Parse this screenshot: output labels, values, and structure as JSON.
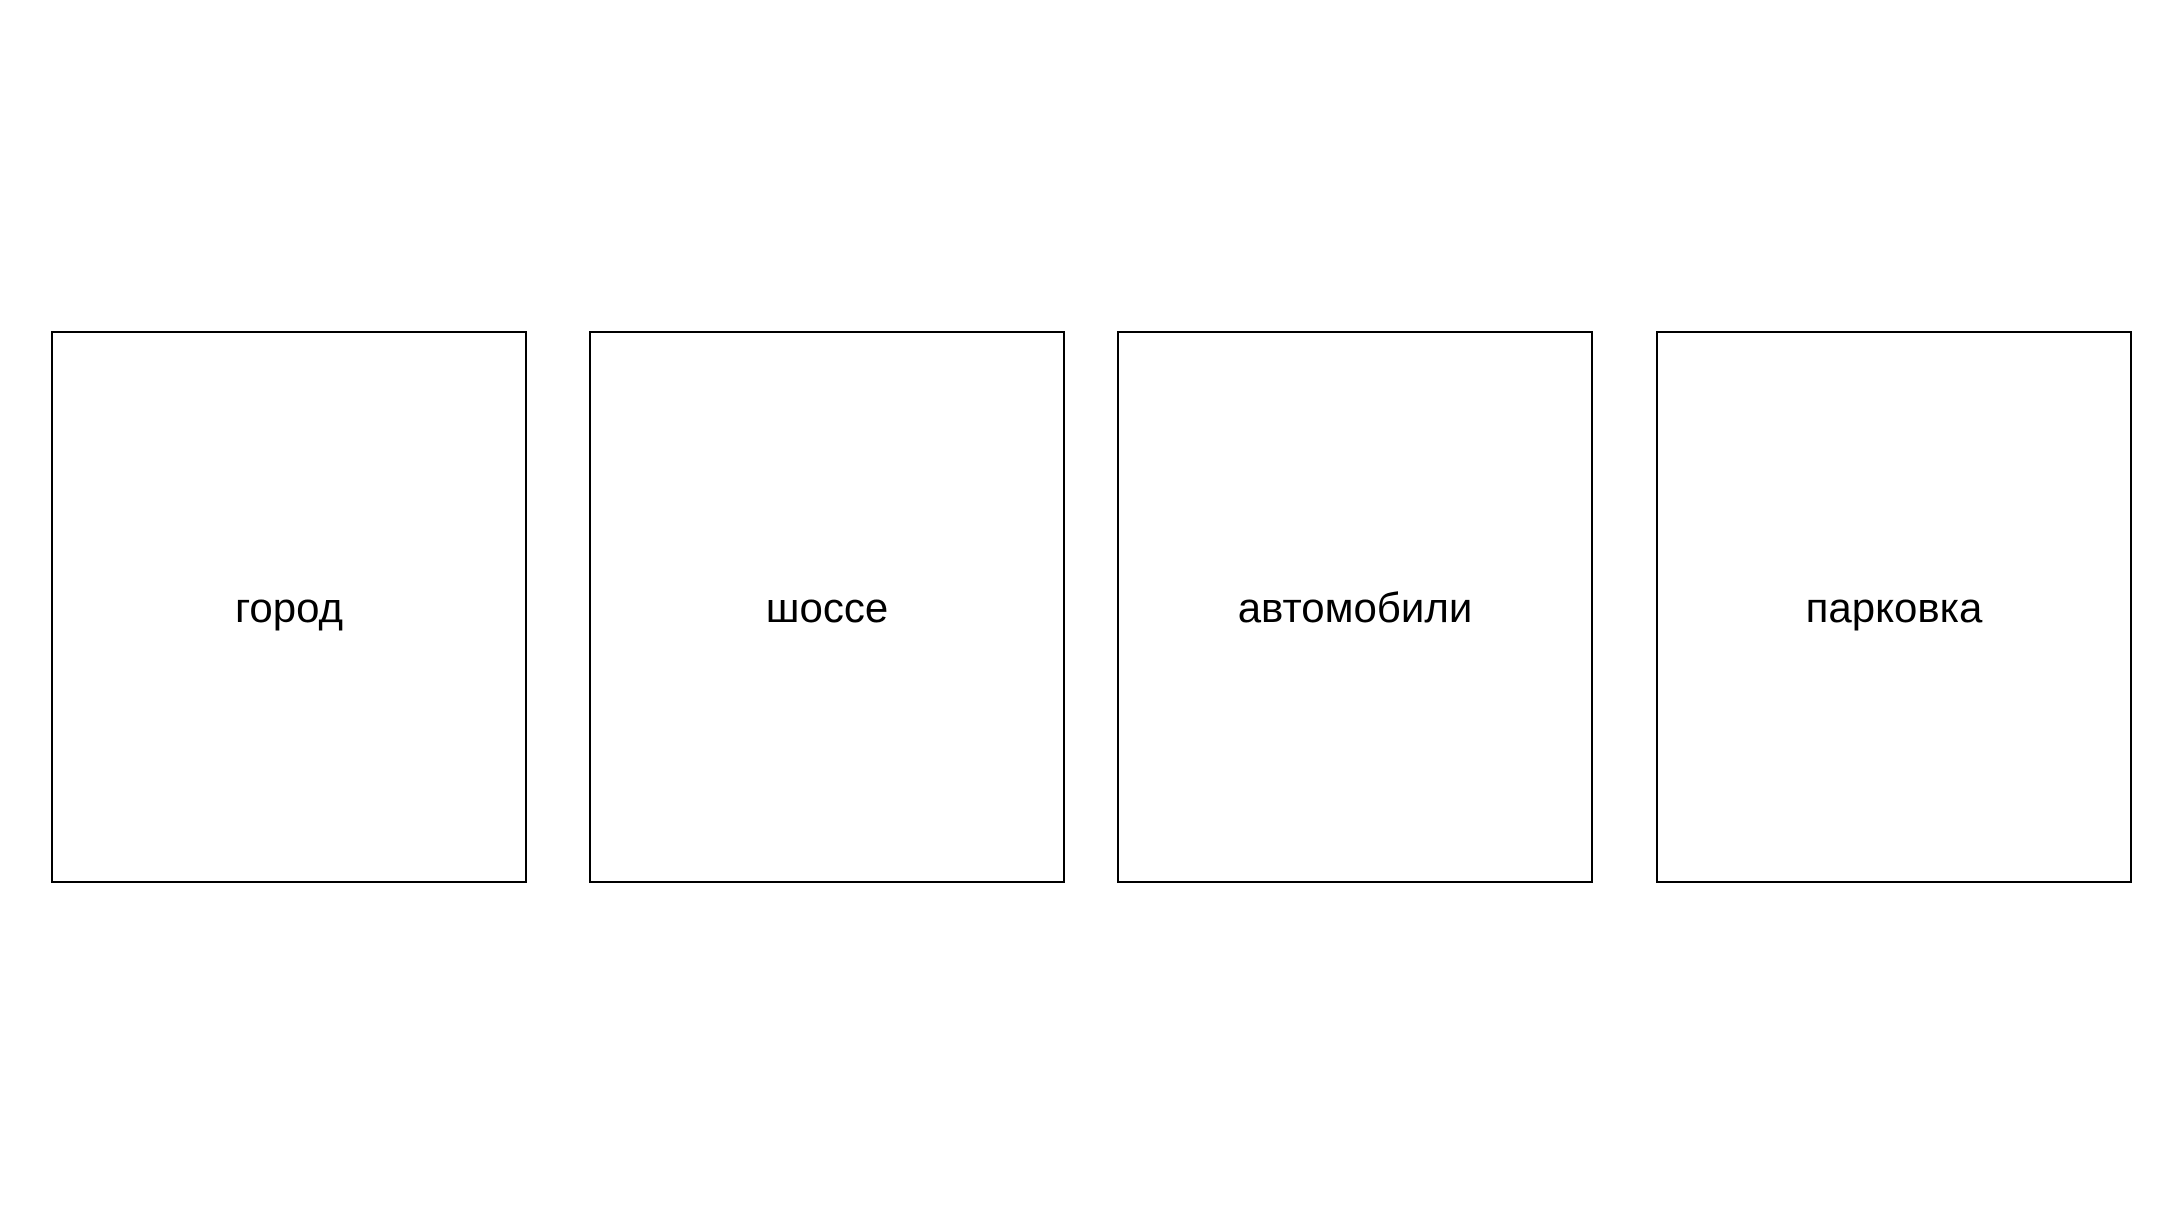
{
  "boxes": [
    {
      "label": "город"
    },
    {
      "label": "шоссе"
    },
    {
      "label": "автомобили"
    },
    {
      "label": "парковка"
    }
  ],
  "colors": {
    "background": "#ffffff",
    "border": "#000000",
    "text": "#000000"
  }
}
